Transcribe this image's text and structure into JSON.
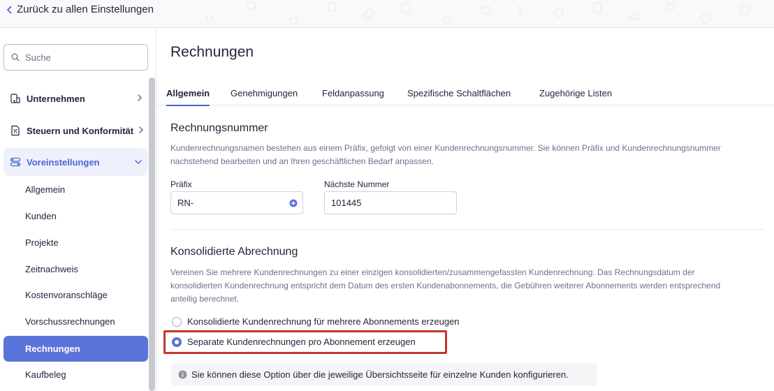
{
  "topbar": {
    "back_label": "Zurück zu allen Einstellungen"
  },
  "sidebar": {
    "search_placeholder": "Suche",
    "groups": [
      {
        "label": "Unternehmen",
        "icon": "building-icon"
      },
      {
        "label": "Steuern und Konformität",
        "icon": "tax-document-icon"
      },
      {
        "label": "Voreinstellungen",
        "icon": "preferences-toggle-icon",
        "expanded": true
      }
    ],
    "items": [
      {
        "label": "Allgemein"
      },
      {
        "label": "Kunden"
      },
      {
        "label": "Projekte"
      },
      {
        "label": "Zeitnachweis"
      },
      {
        "label": "Kostenvoranschläge"
      },
      {
        "label": "Vorschussrechnungen"
      },
      {
        "label": "Rechnungen",
        "active": true
      },
      {
        "label": "Kaufbeleg"
      }
    ]
  },
  "main": {
    "title": "Rechnungen",
    "tabs": [
      {
        "label": "Allgemein",
        "active": true
      },
      {
        "label": "Genehmigungen"
      },
      {
        "label": "Feldanpassung"
      },
      {
        "label": "Spezifische Schaltflächen"
      },
      {
        "label": "Zugehörige Listen"
      }
    ],
    "invoice_number": {
      "title": "Rechnungsnummer",
      "desc_line1": "Kundenrechnungsnamen bestehen aus einem Präfix, gefolgt von einer Kundenrechnungsnummer. Sie können Präfix und Kundenrechnungsnummer",
      "desc_line2": "nachstehend bearbeiten und an Ihren geschäftlichen Bedarf anpassen.",
      "prefix_label": "Präfix",
      "prefix_value": "RN-",
      "next_label": "Nächste Nummer",
      "next_value": "101445"
    },
    "consolidated": {
      "title": "Konsolidierte Abrechnung",
      "desc_line1": "Vereinen Sie mehrere Kundenrechnungen zu einer einzigen konsolidierten/zusammengefassten Kundenrechnung. Das Rechnungsdatum der",
      "desc_line2": "konsolidierten Kundenrechnung entspricht dem Datum des ersten Kundenabonnements, die Gebühren weiterer Abonnements werden entsprechend",
      "desc_line3": "anteilig berechnet.",
      "option1": "Konsolidierte Kundenrechnung für mehrere Abonnements erzeugen",
      "option2": "Separate Kundenrechnungen pro Abonnement erzeugen",
      "selected": "option2",
      "info": "Sie können diese Option über die jeweilige Übersichtsseite für einzelne Kunden konfigurieren."
    }
  },
  "colors": {
    "accent": "#5b74d9",
    "highlight": "#c0392b"
  }
}
